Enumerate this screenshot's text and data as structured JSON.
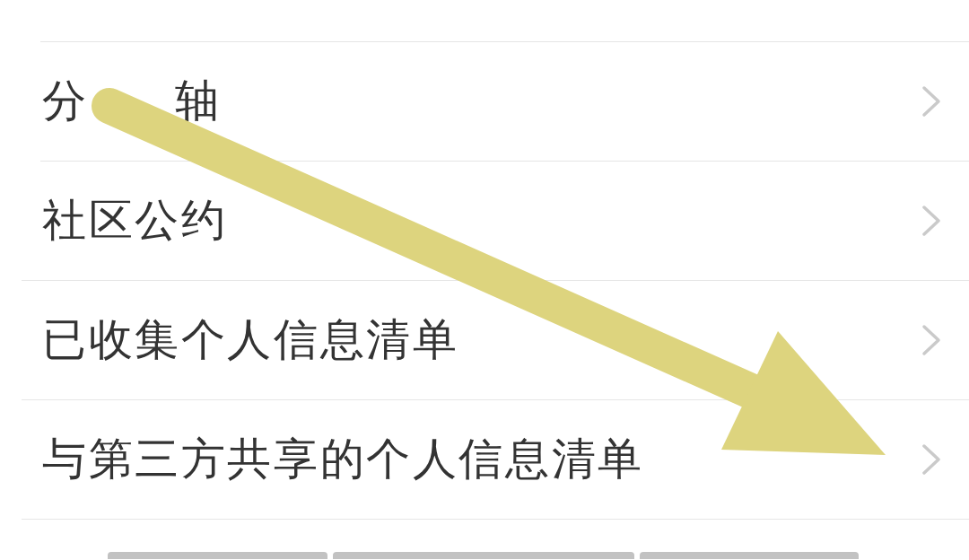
{
  "menu": {
    "items": [
      {
        "label_fragments": [
          "分",
          "轴"
        ]
      },
      {
        "label": "社区公约"
      },
      {
        "label": "已收集个人信息清单"
      },
      {
        "label": "与第三方共享的个人信息清单"
      }
    ]
  }
}
